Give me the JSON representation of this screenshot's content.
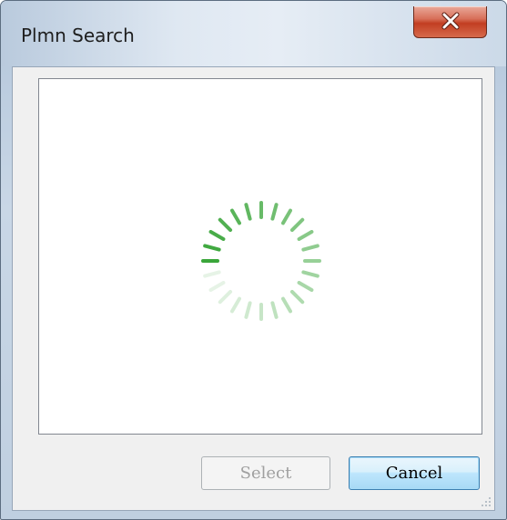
{
  "window": {
    "title": "Plmn Search"
  },
  "titlebar_buttons": {
    "close_icon": "close-x-icon",
    "close_color": "#c94a2e"
  },
  "list": {
    "state": "loading",
    "spinner_icon": "loading-spinner-icon",
    "spinner_color": "#3aa63a"
  },
  "buttons": {
    "select_label": "Select",
    "select_enabled": false,
    "cancel_label": "Cancel",
    "cancel_focused": true
  },
  "resize_grip_icon": "resize-grip-icon"
}
